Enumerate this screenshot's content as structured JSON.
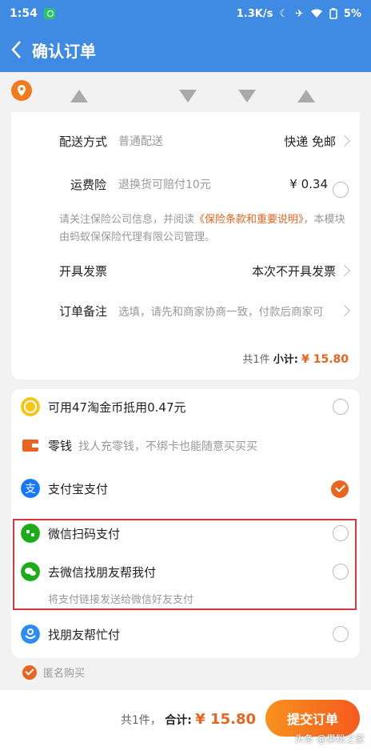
{
  "status": {
    "time": "1:54",
    "speed": "1.3K/s",
    "battery": "5%"
  },
  "header": {
    "title": "确认订单"
  },
  "shipping": {
    "label": "配送方式",
    "sub": "普通配送",
    "value": "快递 免邮"
  },
  "insurance": {
    "label": "运费险",
    "sub": "退换货可赔付10元",
    "value": "¥ 0.34"
  },
  "notice": {
    "prefix": "请关注保险公司信息，并阅读",
    "link": "《保险条款和重要说明》",
    "suffix": "，本模块由蚂蚁保保险代理有限公司管理。"
  },
  "invoice": {
    "label": "开具发票",
    "value": "本次不开具发票"
  },
  "remark": {
    "label": "订单备注",
    "placeholder": "选填，请先和商家协商一致，付款后商家可"
  },
  "subtotal": {
    "count": "共1件",
    "label": "小计:",
    "price": "¥ 15.80"
  },
  "payment": {
    "coins": "可用47淘金币抵用0.47元",
    "change_label": "零钱",
    "change_sub": "找人充零钱，不绑卡也能随意买买买",
    "alipay": "支付宝支付",
    "wechat_scan": "微信扫码支付",
    "wechat_friend": "去微信找朋友帮我付",
    "wechat_note": "将支付链接发送给微信好友支付",
    "friend_pay": "找朋友帮忙付"
  },
  "anonymous": "匿名购买",
  "footer": {
    "count": "共1件，",
    "label": "合计:",
    "amount": "¥ 15.80",
    "submit": "提交订单"
  },
  "watermark": "头条 @果粉之家",
  "colors": {
    "header": "#3f8ae2",
    "accent": "#e8641f",
    "highlight_box": "#d9363e"
  }
}
